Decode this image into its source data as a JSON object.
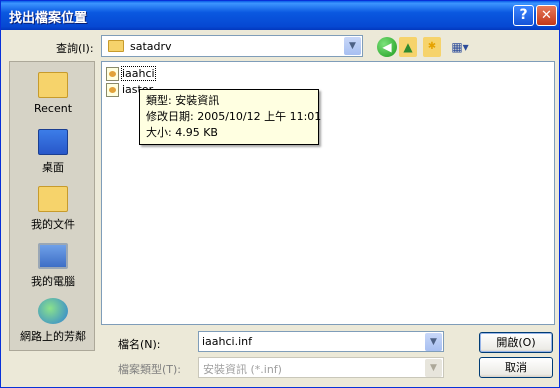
{
  "window": {
    "title": "找出檔案位置",
    "help_symbol": "?",
    "close_symbol": "✕"
  },
  "lookin": {
    "label": "查詢(I):",
    "value": "satadrv"
  },
  "toolbar": {
    "icons": [
      "back-icon",
      "up-folder-icon",
      "new-folder-icon",
      "views-menu-icon"
    ]
  },
  "places": [
    {
      "label": "Recent",
      "icon": "recent-icon"
    },
    {
      "label": "桌面",
      "icon": "desktop-icon"
    },
    {
      "label": "我的文件",
      "icon": "my-documents-icon"
    },
    {
      "label": "我的電腦",
      "icon": "my-computer-icon"
    },
    {
      "label": "網路上的芳鄰",
      "icon": "network-places-icon"
    }
  ],
  "files": [
    {
      "name": "iaahci",
      "selected": true
    },
    {
      "name": "iastor",
      "selected": false
    }
  ],
  "tooltip": {
    "type": "類型: 安裝資訊",
    "modified": "修改日期: 2005/10/12 上午 11:01",
    "size": "大小: 4.95 KB"
  },
  "filename": {
    "label": "檔名(N):",
    "value": "iaahci.inf"
  },
  "filetype": {
    "label": "檔案類型(T):",
    "value": "安裝資訊 (*.inf)"
  },
  "buttons": {
    "open": "開啟(O)",
    "cancel": "取消"
  }
}
